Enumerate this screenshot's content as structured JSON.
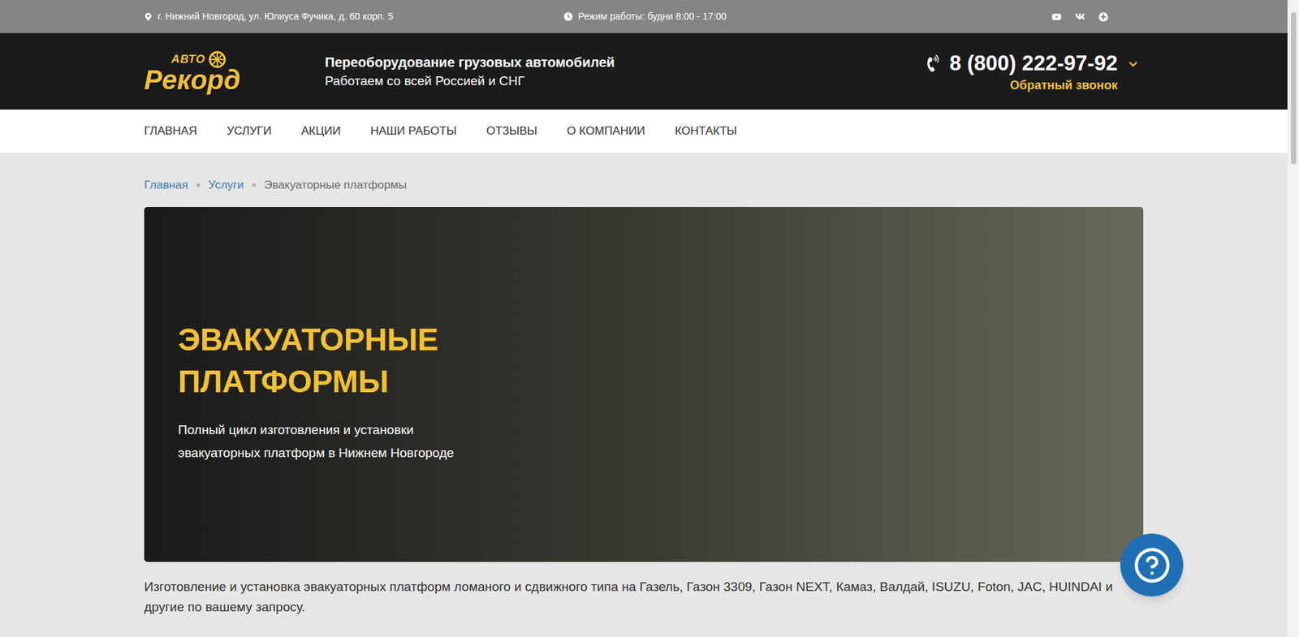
{
  "top_bar": {
    "address": "г. Нижний Новгород, ул. Юлиуса Фучика, д. 60 корп. 5",
    "hours": "Режим работы: будни 8:00 - 17:00"
  },
  "logo": {
    "top": "АВТО",
    "main": "Рекорд"
  },
  "header": {
    "tagline": "Переоборудование грузовых автомобилей",
    "subtitle": "Работаем со всей Россией и СНГ",
    "phone": "8 (800) 222-97-92",
    "callback": "Обратный звонок"
  },
  "nav": [
    {
      "label": "ГЛАВНАЯ",
      "selected": false
    },
    {
      "label": "УСЛУГИ",
      "selected": false
    },
    {
      "label": "АКЦИИ",
      "selected": false
    },
    {
      "label": "НАШИ РАБОТЫ",
      "selected": false
    },
    {
      "label": "ОТЗЫВЫ",
      "selected": false
    },
    {
      "label": "О КОМПАНИИ",
      "selected": false
    },
    {
      "label": "КОНТАКТЫ",
      "selected": false
    }
  ],
  "breadcrumbs": [
    {
      "label": "Главная",
      "current": false
    },
    {
      "label": "Услуги",
      "current": false
    },
    {
      "label": "Эвакуаторные платформы",
      "current": true
    }
  ],
  "hero": {
    "title_lines": [
      "ЭВАКУАТОРНЫЕ",
      "ПЛАТФОРМЫ"
    ],
    "subtitle_lines": [
      "Полный цикл изготовления и установки",
      "эвакуаторных платформ в Нижнем Новгороде"
    ]
  },
  "intro": "Изготовление и установка эвакуаторных платформ ломаного и сдвижного типа на Газель, Газон 3309, Газон NEXT, Камаз, Валдай, ISUZU, Foton, JAC, HUINDAI и другие по вашему запросу."
}
